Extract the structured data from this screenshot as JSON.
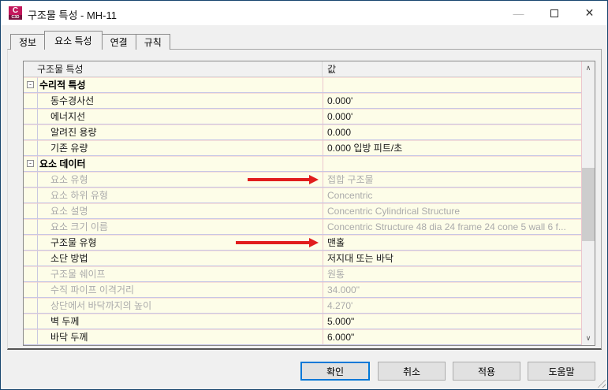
{
  "window": {
    "title": "구조물 특성 - MH-11",
    "app_icon": {
      "letter": "C",
      "sub": "C3D"
    },
    "controls": {
      "minimize": "—",
      "maximize": "",
      "close": "✕"
    }
  },
  "tabs": [
    {
      "label": "정보",
      "active": false
    },
    {
      "label": "요소 특성",
      "active": true
    },
    {
      "label": "연결",
      "active": false
    },
    {
      "label": "규칙",
      "active": false
    }
  ],
  "grid": {
    "header": {
      "property": "구조물 특성",
      "value": "값"
    },
    "rows": [
      {
        "kind": "section",
        "label": "수리적 특성",
        "value": "",
        "toggle": "-"
      },
      {
        "kind": "item",
        "label": "동수경사선",
        "value": "0.000'",
        "readonly": false
      },
      {
        "kind": "item",
        "label": "에너지선",
        "value": "0.000'",
        "readonly": false
      },
      {
        "kind": "item",
        "label": "알려진 용량",
        "value": "0.000",
        "readonly": false
      },
      {
        "kind": "item",
        "label": "기존 유량",
        "value": "0.000 입방 피트/초",
        "readonly": false
      },
      {
        "kind": "section",
        "label": "요소 데이터",
        "value": "",
        "toggle": "-"
      },
      {
        "kind": "item",
        "label": "요소 유형",
        "value": "접합 구조물",
        "readonly": true,
        "arrow": true,
        "arrow_len": 78
      },
      {
        "kind": "item",
        "label": "요소 하위 유형",
        "value": "Concentric",
        "readonly": true
      },
      {
        "kind": "item",
        "label": "요소 설명",
        "value": "Concentric Cylindrical Structure",
        "readonly": true
      },
      {
        "kind": "item",
        "label": "요소 크기 이름",
        "value": "Concentric Structure 48 dia 24 frame 24 cone 5 wall 6 f...",
        "readonly": true
      },
      {
        "kind": "item",
        "label": "구조물 유형",
        "value": "맨홀",
        "readonly": false,
        "arrow": true,
        "arrow_len": 93
      },
      {
        "kind": "item",
        "label": "소단 방법",
        "value": "저지대 또는 바닥",
        "readonly": false
      },
      {
        "kind": "item",
        "label": "구조물 쉐이프",
        "value": "원통",
        "readonly": true
      },
      {
        "kind": "item",
        "label": "수직 파이프 이격거리",
        "value": "34.000\"",
        "readonly": true
      },
      {
        "kind": "item",
        "label": "상단에서 바닥까지의 높이",
        "value": "4.270'",
        "readonly": true
      },
      {
        "kind": "item",
        "label": "벽 두께",
        "value": "5.000\"",
        "readonly": false
      },
      {
        "kind": "item",
        "label": "바닥 두께",
        "value": "6.000\"",
        "readonly": false
      }
    ]
  },
  "scrollbar": {
    "up": "∧",
    "down": "∨"
  },
  "buttons": [
    {
      "label": "확인",
      "focused": true
    },
    {
      "label": "취소",
      "focused": false
    },
    {
      "label": "적용",
      "focused": false
    },
    {
      "label": "도움말",
      "focused": false
    }
  ],
  "colors": {
    "accent": "#0078d7",
    "annotation_arrow": "#e11d1d",
    "cell_background": "#fdfde8",
    "row_line": "#c7c7e6",
    "column_line": "#ecc6ce",
    "readonly_text": "#ababab",
    "icon_brand": "#c2175b"
  }
}
